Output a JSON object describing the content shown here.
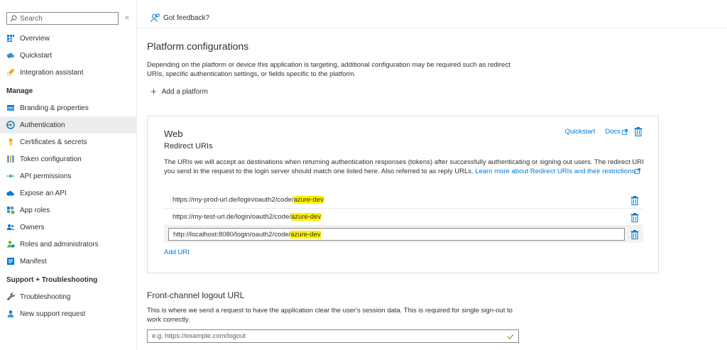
{
  "sidebar": {
    "search_placeholder": "Search",
    "collapse_label": "«",
    "items_top": [
      {
        "label": "Overview",
        "icon": "overview-grid-icon"
      },
      {
        "label": "Quickstart",
        "icon": "quickstart-cloud-icon"
      },
      {
        "label": "Integration assistant",
        "icon": "rocket-icon"
      }
    ],
    "section_manage": "Manage",
    "items_manage": [
      {
        "label": "Branding & properties",
        "icon": "branding-icon"
      },
      {
        "label": "Authentication",
        "icon": "authentication-icon",
        "active": true
      },
      {
        "label": "Certificates & secrets",
        "icon": "key-icon"
      },
      {
        "label": "Token configuration",
        "icon": "token-bars-icon"
      },
      {
        "label": "API permissions",
        "icon": "api-permissions-icon"
      },
      {
        "label": "Expose an API",
        "icon": "cloud-api-icon"
      },
      {
        "label": "App roles",
        "icon": "app-roles-icon"
      },
      {
        "label": "Owners",
        "icon": "owners-icon"
      },
      {
        "label": "Roles and administrators",
        "icon": "roles-admin-icon"
      },
      {
        "label": "Manifest",
        "icon": "manifest-icon"
      }
    ],
    "section_support": "Support + Troubleshooting",
    "items_support": [
      {
        "label": "Troubleshooting",
        "icon": "wrench-icon"
      },
      {
        "label": "New support request",
        "icon": "support-person-icon"
      }
    ]
  },
  "topbar": {
    "feedback_label": "Got feedback?"
  },
  "main": {
    "title": "Platform configurations",
    "description": "Depending on the platform or device this application is targeting, additional configuration may be required such as redirect URIs, specific authentication settings, or fields specific to the platform.",
    "add_platform_label": "Add a platform",
    "web_card": {
      "title": "Web",
      "subtitle": "Redirect URIs",
      "quickstart_label": "Quickstart",
      "docs_label": "Docs",
      "description": "The URIs we will accept as destinations when returning authentication responses (tokens) after successfully authenticating or signing out users. The redirect URI you send in the request to the login server should match one listed here. Also referred to as reply URLs. ",
      "learn_more_label": "Learn more about Redirect URIs and their restrictions",
      "uris": [
        {
          "prefix": "https://my-prod-url.de/login/oauth2/code/",
          "highlight": "azure-dev"
        },
        {
          "prefix": "https://my-test-url.de/login/oauth2/code/",
          "highlight": "azure-dev"
        },
        {
          "prefix": "http://localhost:8080/login/oauth2/code/",
          "highlight": "azure-dev"
        }
      ],
      "add_uri_label": "Add URI"
    },
    "logout": {
      "title": "Front-channel logout URL",
      "description": "This is where we send a request to have the application clear the user's session data. This is required for single sign-out to work correctly.",
      "placeholder": "e.g. https://example.com/logout"
    }
  },
  "colors": {
    "accent": "#0078d4",
    "highlight": "#fff200",
    "active_nav": "#ededed"
  }
}
